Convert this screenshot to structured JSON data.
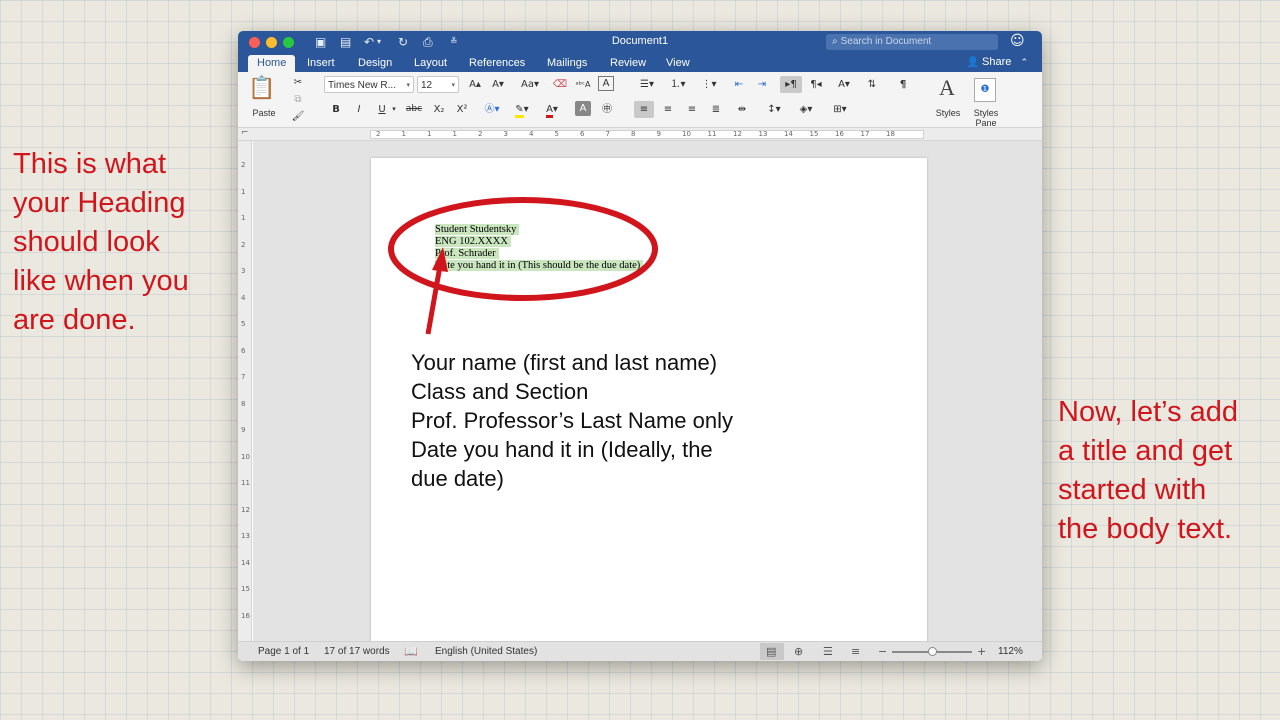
{
  "notes": {
    "left": [
      "This is what",
      "your Heading",
      "should look",
      "like when you",
      "are done."
    ],
    "right": [
      "Now, let’s add",
      "a title and get",
      "started with",
      "the body text."
    ]
  },
  "titlebar": {
    "doc_title": "Document1",
    "search_placeholder": "Search in Document"
  },
  "tabs": {
    "home": "Home",
    "insert": "Insert",
    "design": "Design",
    "layout": "Layout",
    "references": "References",
    "mailings": "Mailings",
    "review": "Review",
    "view": "View",
    "share": "Share"
  },
  "ribbon": {
    "paste_label": "Paste",
    "font_name": "Times New R...",
    "font_size": "12",
    "bold": "B",
    "italic": "I",
    "underline": "U",
    "strike": "abc",
    "subscript": "X₂",
    "superscript": "X²",
    "styles_label": "Styles",
    "styles_pane_label": [
      "Styles",
      "Pane"
    ]
  },
  "ruler": {
    "top_ticks": [
      "2",
      "1",
      "1",
      "1",
      "2",
      "3",
      "4",
      "5",
      "6",
      "7",
      "8",
      "9",
      "10",
      "11",
      "12",
      "13",
      "14",
      "15",
      "16",
      "17",
      "18"
    ],
    "left_ticks": [
      "2",
      "1",
      "1",
      "2",
      "3",
      "4",
      "5",
      "6",
      "7",
      "8",
      "9",
      "10",
      "11",
      "12",
      "13",
      "14",
      "15",
      "16"
    ]
  },
  "document": {
    "heading_lines": [
      "Student Studentsky",
      "ENG 102.XXXX",
      "Prof. Schrader",
      "Date you hand it in (This should be the due date)"
    ],
    "instruction_lines": [
      "Your name (first and last name)",
      "Class and Section",
      "Prof. Professor’s Last Name only",
      "Date you hand it in (Ideally, the",
      "due date)"
    ]
  },
  "status": {
    "page": "Page 1 of 1",
    "words": "17 of 17 words",
    "language": "English (United States)",
    "zoom": "112%",
    "zoom_fraction": 0.5
  },
  "colors": {
    "accent": "#2b579a",
    "annotation": "#d0161c",
    "highlight": "#c9e6bf"
  }
}
